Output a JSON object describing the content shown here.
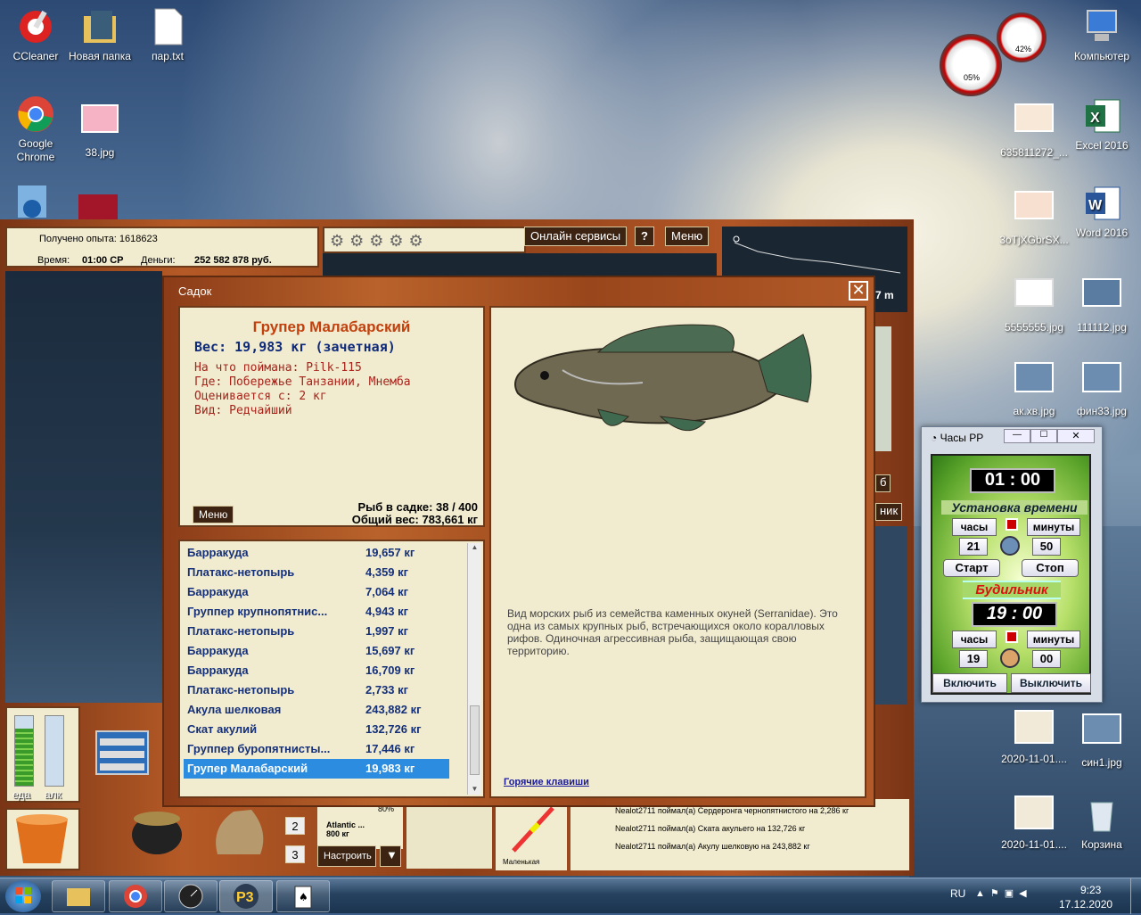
{
  "desktop": {
    "left_icons": [
      {
        "label": "CCleaner"
      },
      {
        "label": "Новая папка"
      },
      {
        "label": "пар.txt"
      },
      {
        "label": "Google Chrome"
      },
      {
        "label": "38.jpg"
      }
    ],
    "right_icons": [
      {
        "label": "Компьютер"
      },
      {
        "label": "635811272_..."
      },
      {
        "label": "Excel 2016"
      },
      {
        "label": "3oTjXGbrSX..."
      },
      {
        "label": "Word 2016"
      },
      {
        "label": "5555555.jpg"
      },
      {
        "label": "111112.jpg"
      },
      {
        "label": "ак.хв.jpg"
      },
      {
        "label": "фин33.jpg"
      },
      {
        "label": "2020-11-01...."
      },
      {
        "label": "син1.jpg"
      },
      {
        "label": "2020-11-01...."
      },
      {
        "label": "Корзина"
      }
    ],
    "gauges": {
      "cpu": "05%",
      "mem": "42%"
    }
  },
  "game": {
    "exp_label": "Получено опыта: 1618623",
    "time_label": "Время:",
    "time_value": "01:00 СР",
    "money_label": "Деньги:",
    "money_value": "252 582 878 руб.",
    "online_services": "Онлайн сервисы",
    "help": "?",
    "menu": "Меню",
    "depth": "7 m",
    "food_label": "еда",
    "alc_label": "алк",
    "slot2": "2",
    "slot3": "3",
    "tune": "Настроить",
    "bait_name": "Atlantic ...",
    "bait_weight": "800 кг",
    "bait_pct": "80%",
    "lure_label": "Маленькая",
    "cut_right_1": "б",
    "cut_right_2": "ник",
    "chat": [
      "Nealot2711 поймал(а) Сердеронга чернопятнистого на 2,286 кг",
      "Nealot2711 поймал(а) Ската акульего на 132,726 кг",
      "Nealot2711 поймал(а) Акулу шелковую на 243,882 кг"
    ]
  },
  "keepnet": {
    "title": "Садок",
    "close": "✕",
    "fish_name": "Групер Малабарский",
    "weight": "Вес: 19,983 кг (зачетная)",
    "caught_on": "На что поймана: Pilk-115",
    "where": "Где: Побережье Танзании, Мнемба",
    "rated": "Оценивается с: 2 кг",
    "kind": "Вид: Редчайший",
    "menu_btn": "Меню",
    "fish_count": "Рыб в садке: 38 / 400",
    "total_weight": "Общий вес: 783,661 кг",
    "description": "Вид морских рыб из семейства каменных окуней (Serranidae). Это одна из самых крупных рыб, встречающихся около коралловых рифов. Одиночная агрессивная рыба, защищающая свою территорию.",
    "hotkeys": "Горячие клавиши",
    "list": [
      {
        "name": "Барракуда",
        "weight": "19,657 кг"
      },
      {
        "name": "Платакс-нетопырь",
        "weight": "4,359 кг"
      },
      {
        "name": "Барракуда",
        "weight": "7,064 кг"
      },
      {
        "name": "Группер крупнопятнис...",
        "weight": "4,943 кг"
      },
      {
        "name": "Платакс-нетопырь",
        "weight": "1,997 кг"
      },
      {
        "name": "Барракуда",
        "weight": "15,697 кг"
      },
      {
        "name": "Барракуда",
        "weight": "16,709 кг"
      },
      {
        "name": "Платакс-нетопырь",
        "weight": "2,733 кг"
      },
      {
        "name": "Акула шелковая",
        "weight": "243,882 кг"
      },
      {
        "name": "Скат акулий",
        "weight": "132,726 кг"
      },
      {
        "name": "Группер буропятнисты...",
        "weight": "17,446 кг"
      },
      {
        "name": "Групер Малабарский",
        "weight": "19,983 кг"
      }
    ]
  },
  "clock_app": {
    "title": "Часы РР",
    "current": "01 : 00",
    "set_time": "Установка времени",
    "hours": "часы",
    "minutes": "минуты",
    "set_h": "21",
    "set_m": "50",
    "start": "Старт",
    "stop": "Стоп",
    "alarm": "Будильник",
    "alarm_time": "19 : 00",
    "alarm_h": "19",
    "alarm_m": "00",
    "enable": "Включить",
    "disable": "Выключить"
  },
  "taskbar": {
    "lang": "RU",
    "time": "9:23",
    "date": "17.12.2020"
  }
}
